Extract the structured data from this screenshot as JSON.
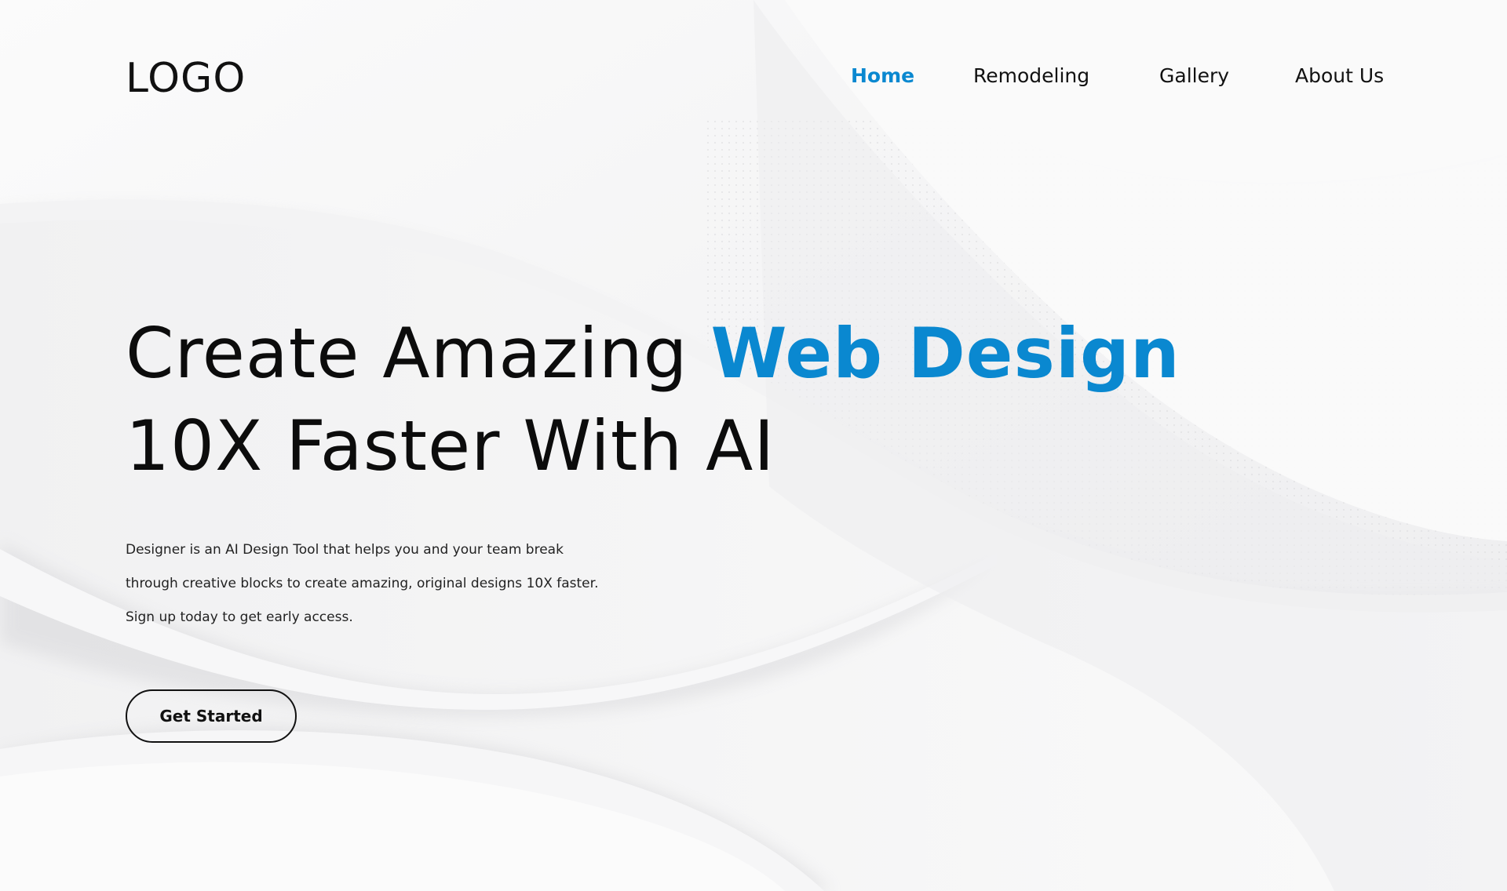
{
  "brand": {
    "logo_text": "LOGO"
  },
  "nav": {
    "items": [
      {
        "label": "Home",
        "active": true
      },
      {
        "label": "Remodeling",
        "active": false
      },
      {
        "label": "Gallery",
        "active": false
      },
      {
        "label": "About Us",
        "active": false
      }
    ]
  },
  "hero": {
    "title_part1": "Create Amazing ",
    "title_accent": "Web Design",
    "title_line2": "10X Faster With AI",
    "description_lines": [
      "Designer is an AI Design Tool that helps you and your team break",
      "through creative blocks to create amazing, original designs 10X faster.",
      "Sign up today to get early access."
    ],
    "cta_label": "Get Started"
  },
  "colors": {
    "accent": "#0a88d0",
    "text": "#111111",
    "background": "#f4f4f5"
  }
}
